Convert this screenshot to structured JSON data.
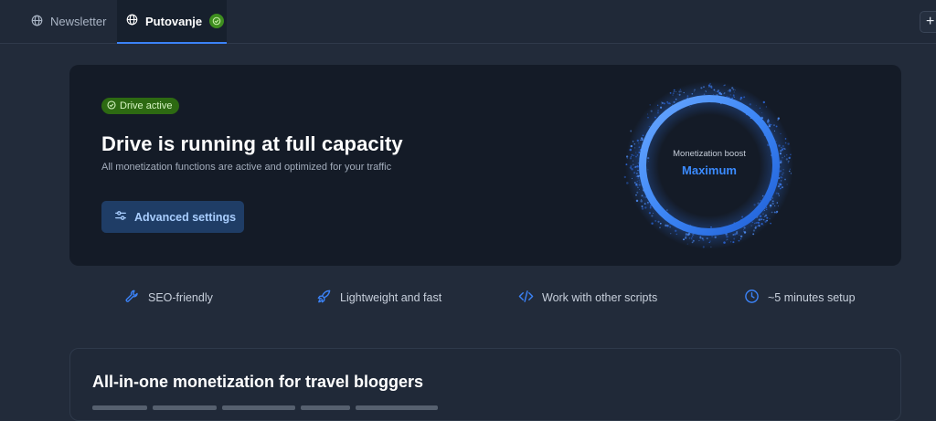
{
  "tabs": [
    {
      "label": "Newsletter",
      "icon": "globe-icon",
      "active": false
    },
    {
      "label": "Putovanje",
      "icon": "globe-icon",
      "active": true,
      "status_icon": "check-circle-icon"
    }
  ],
  "tabbar": {
    "add_label": "+"
  },
  "hero": {
    "badge": "Drive active",
    "title": "Drive is running at full capacity",
    "subtitle": "All monetization functions are active and optimized for your traffic",
    "button_label": "Advanced settings",
    "button_icon": "sliders-icon",
    "gauge_label": "Monetization boost",
    "gauge_value": "Maximum"
  },
  "features": [
    {
      "label": "SEO-friendly",
      "icon": "wrench-icon"
    },
    {
      "label": "Lightweight and fast",
      "icon": "rocket-icon"
    },
    {
      "label": "Work with other scripts",
      "icon": "code-icon"
    },
    {
      "label": "~5 minutes setup",
      "icon": "clock-icon"
    }
  ],
  "lower": {
    "title": "All-in-one monetization for travel bloggers"
  },
  "colors": {
    "accent": "#3b82f6",
    "success": "#2d6a12",
    "background": "#222b3a",
    "card": "#141b27"
  }
}
